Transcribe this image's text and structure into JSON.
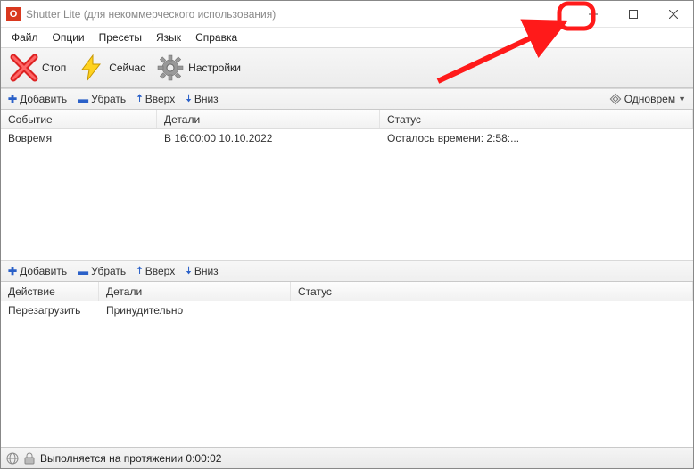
{
  "window": {
    "title": "Shutter Lite (для некоммерческого использования)",
    "appicon_glyph": "O"
  },
  "menubar": {
    "file": "Файл",
    "options": "Опции",
    "presets": "Пресеты",
    "language": "Язык",
    "help": "Справка"
  },
  "toolbar": {
    "stop": "Стоп",
    "now": "Сейчас",
    "settings": "Настройки"
  },
  "subbar": {
    "add": "Добавить",
    "remove": "Убрать",
    "up": "Вверх",
    "down": "Вниз",
    "mode_label": "Одноврем"
  },
  "events": {
    "headers": {
      "event": "Событие",
      "details": "Детали",
      "status": "Статус"
    },
    "rows": [
      {
        "event": "Вовремя",
        "details": "В 16:00:00 10.10.2022",
        "status": "Осталось времени: 2:58:..."
      }
    ]
  },
  "actions": {
    "headers": {
      "action": "Действие",
      "details": "Детали",
      "status": "Статус"
    },
    "rows": [
      {
        "action": "Перезагрузить",
        "details": "Принудительно",
        "status": ""
      }
    ]
  },
  "statusbar": {
    "text": "Выполняется на протяжении 0:00:02"
  }
}
